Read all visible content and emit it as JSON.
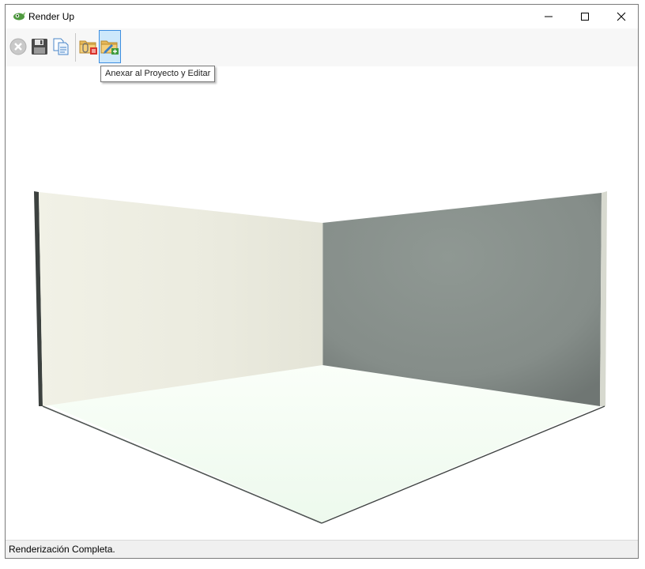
{
  "window": {
    "title": "Render Up",
    "icon": "app-leaf-icon",
    "controls": {
      "minimize": "—",
      "maximize": "☐",
      "close": "✕"
    }
  },
  "toolbar": {
    "buttons": [
      {
        "name": "cancel-render",
        "icon": "cancel-icon",
        "enabled": false
      },
      {
        "name": "save",
        "icon": "save-disk-icon"
      },
      {
        "name": "copy",
        "icon": "copy-pages-icon"
      },
      {
        "name": "attach-to-project",
        "icon": "folder-attach-icon"
      },
      {
        "name": "attach-to-project-and-edit",
        "icon": "folder-edit-icon",
        "active": true
      }
    ],
    "tooltip": "Anexar al Proyecto y Editar"
  },
  "scene": {
    "left_wall_color": "#ebebdf",
    "right_wall_color": "#878f8a",
    "floor_color": "#f1fcf1",
    "edge_color": "#5d6361"
  },
  "status": {
    "text": "Renderización Completa."
  }
}
